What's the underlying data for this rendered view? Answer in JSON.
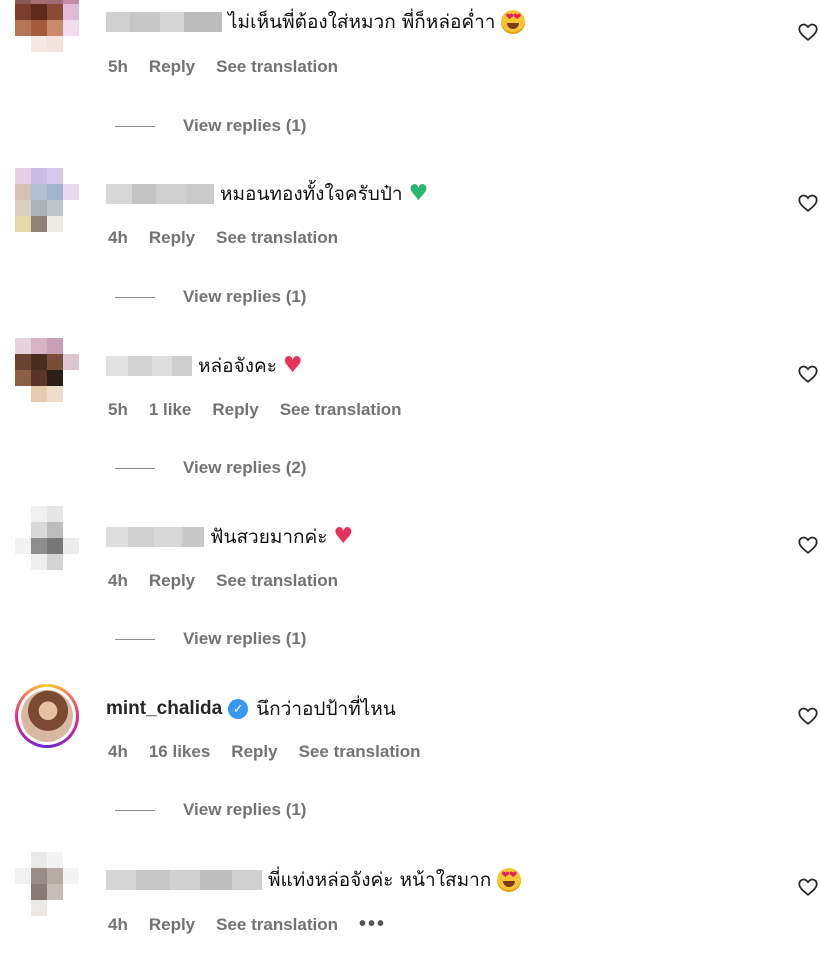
{
  "ui": {
    "reply_label": "Reply",
    "translate_label": "See translation",
    "more_label": "•••"
  },
  "comments": [
    {
      "time": "5h",
      "likes": "",
      "text": "ไม่เห็นพี่ต้องใส่หมวก พี่ก็หล่อค่ำา",
      "emoji": "heart-eyes",
      "replies": "View replies (1)"
    },
    {
      "time": "4h",
      "likes": "",
      "text": "หมอนทองทั้งใจครับป๋า",
      "emoji": "green-heart",
      "replies": "View replies (1)"
    },
    {
      "time": "5h",
      "likes": "1 like",
      "text": "หล่อจังคะ",
      "emoji": "red-heart",
      "replies": "View replies (2)"
    },
    {
      "time": "4h",
      "likes": "",
      "text": "ฟันสวยมากค่ะ",
      "emoji": "red-heart",
      "replies": "View replies (1)"
    },
    {
      "time": "4h",
      "likes": "16 likes",
      "username": "mint_chalida",
      "verified": true,
      "text": "นึกว่าอปป้าที่ไหน",
      "emoji": "",
      "replies": "View replies (1)"
    },
    {
      "time": "4h",
      "likes": "",
      "text": "พี่แท่งหล่อจังค่ะ หน้าใสมาก",
      "emoji": "heart-eyes",
      "replies": ""
    }
  ],
  "colors": {
    "verified": "#3897f0",
    "meta_gray": "#737373",
    "green_heart": "#2bb673",
    "red_heart": "#e8315b"
  }
}
